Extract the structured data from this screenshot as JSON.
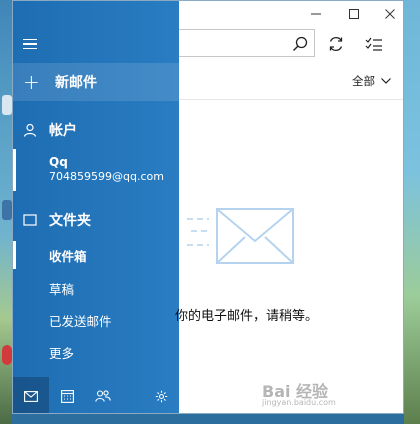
{
  "sidebar": {
    "new_mail": "新邮件",
    "accounts_header": "帐户",
    "account": {
      "name": "Qq",
      "email": "704859599@qq.com"
    },
    "folders_header": "文件夹",
    "folders": [
      {
        "label": "收件箱",
        "selected": true
      },
      {
        "label": "草稿",
        "selected": false
      },
      {
        "label": "已发送邮件",
        "selected": false
      },
      {
        "label": "更多",
        "selected": false
      }
    ],
    "bottom_icons": [
      "mail-icon",
      "calendar-icon",
      "people-icon",
      "settings-icon"
    ]
  },
  "content": {
    "filter_label": "全部",
    "loading_message": "你的电子邮件，请稍等。",
    "toolbar_icons": [
      "search-icon",
      "sync-icon",
      "select-mode-icon"
    ]
  },
  "window_controls": [
    "minimize-icon",
    "maximize-icon",
    "close-icon"
  ],
  "watermark": {
    "text": "Bai 经验",
    "sub": "jingyan.baidu.com"
  },
  "colors": {
    "sidebar": "#1e6db3",
    "accent": "#2a7dc2",
    "envelope": "#c6def2"
  }
}
